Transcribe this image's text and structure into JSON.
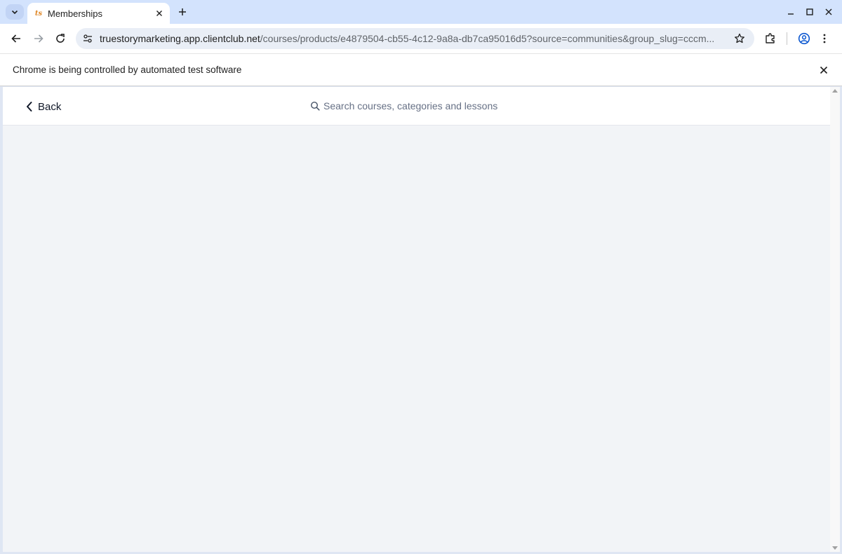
{
  "browser": {
    "tab": {
      "title": "Memberships",
      "favicon_text": "ts"
    },
    "url": {
      "host": "truestorymarketing.app.clientclub.net",
      "path": "/courses/products/e4879504-cb55-4c12-9a8a-db7ca95016d5?source=communities&group_slug=cccm..."
    },
    "infobar": {
      "message": "Chrome is being controlled by automated test software"
    }
  },
  "page": {
    "back_label": "Back",
    "search": {
      "placeholder": "Search courses, categories and lessons"
    }
  }
}
